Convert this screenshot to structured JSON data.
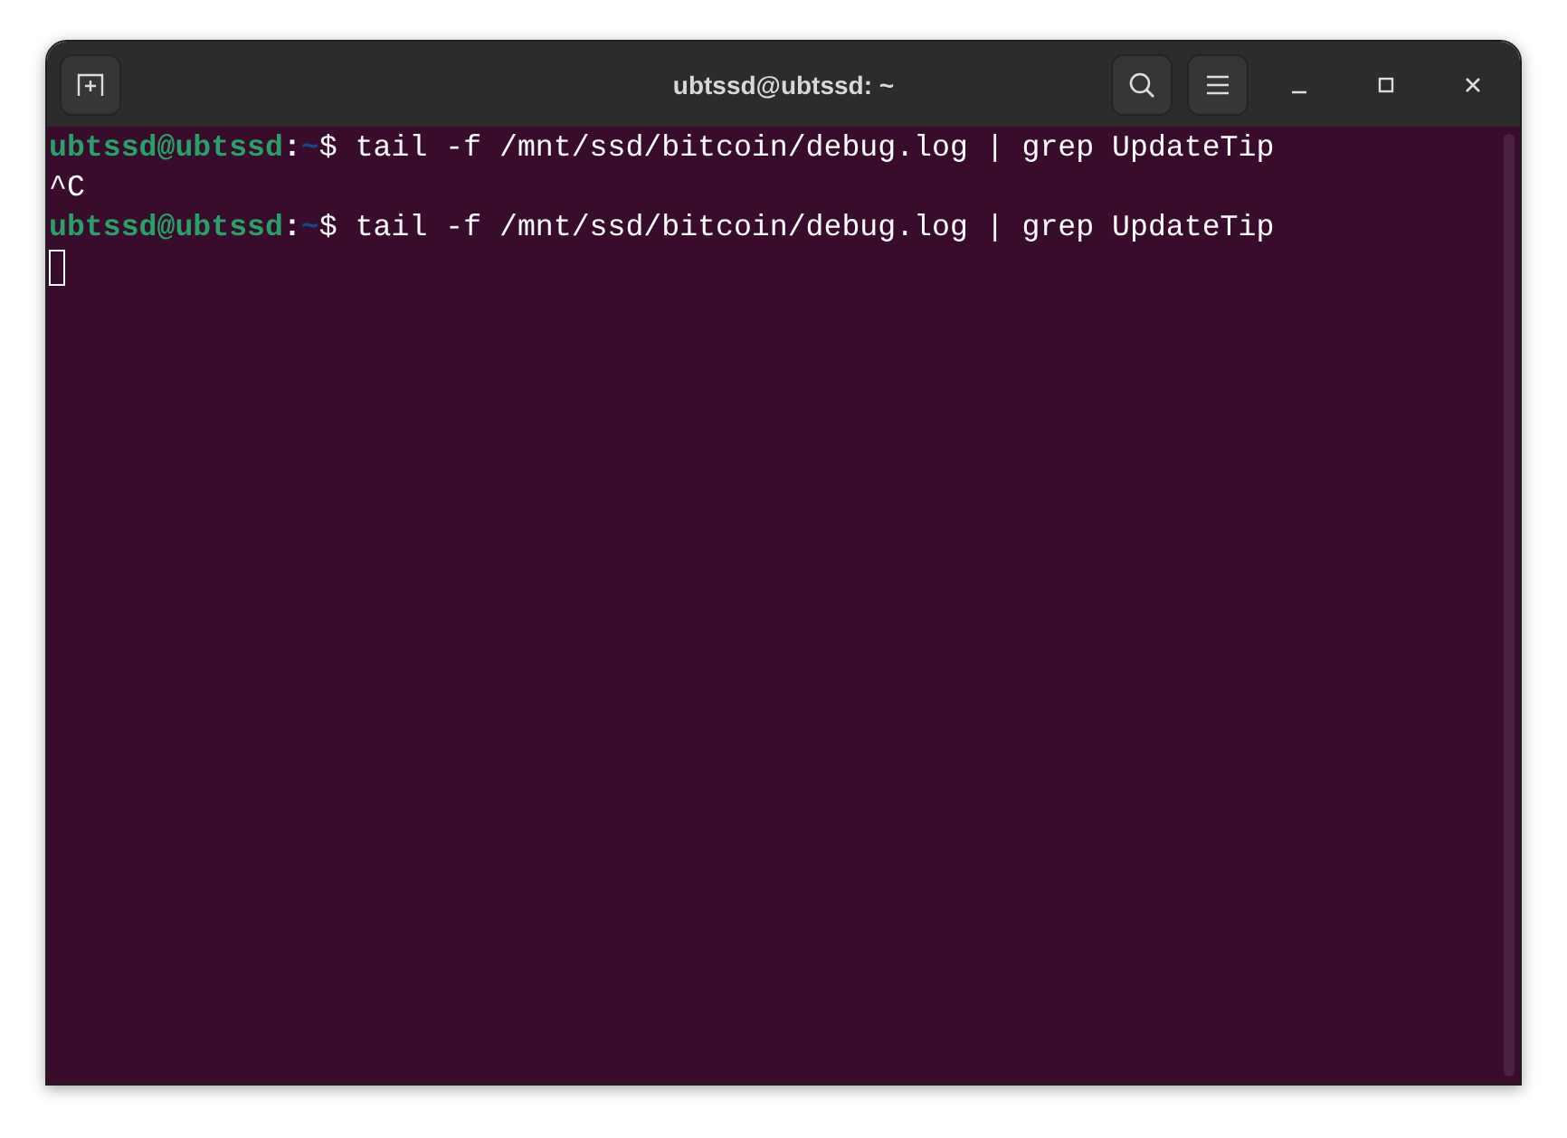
{
  "window": {
    "title": "ubtssd@ubtssd: ~"
  },
  "terminal": {
    "lines": [
      {
        "kind": "prompt",
        "user": "ubtssd@ubtssd",
        "separator": ":",
        "path": "~",
        "symbol": "$",
        "command": "tail -f /mnt/ssd/bitcoin/debug.log | grep UpdateTip"
      },
      {
        "kind": "output",
        "text": "^C"
      },
      {
        "kind": "prompt",
        "user": "ubtssd@ubtssd",
        "separator": ":",
        "path": "~",
        "symbol": "$",
        "command": "tail -f /mnt/ssd/bitcoin/debug.log | grep UpdateTip"
      },
      {
        "kind": "cursor"
      }
    ]
  }
}
